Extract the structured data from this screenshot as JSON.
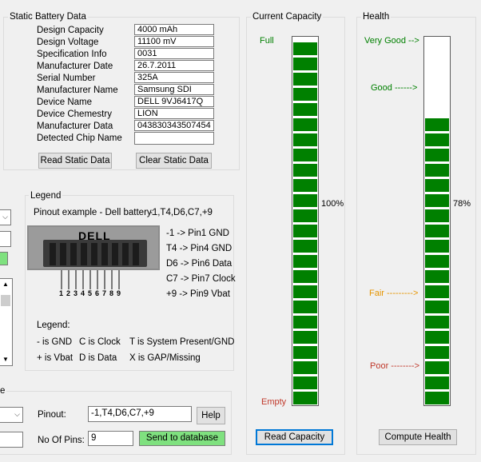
{
  "static": {
    "title": "Static Battery Data",
    "rows": [
      {
        "label": "Design Capacity",
        "value": "4000 mAh"
      },
      {
        "label": "Design Voltage",
        "value": "11100 mV"
      },
      {
        "label": "Specification Info",
        "value": "0031"
      },
      {
        "label": "Manufacturer Date",
        "value": "26.7.2011"
      },
      {
        "label": "Serial Number",
        "value": "325A"
      },
      {
        "label": "Manufacturer Name",
        "value": "Samsung SDI"
      },
      {
        "label": "Device Name",
        "value": "DELL 9VJ6417Q"
      },
      {
        "label": "Device Chemestry",
        "value": "LION"
      },
      {
        "label": "Manufacturer Data",
        "value": "043830343507454"
      },
      {
        "label": "Detected Chip Name",
        "value": ""
      }
    ],
    "read_btn": "Read Static Data",
    "clear_btn": "Clear Static Data"
  },
  "capacity": {
    "title": "Current Capacity",
    "full_label": "Full",
    "empty_label": "Empty",
    "percent_text": "100%",
    "fill_fraction": 1.0,
    "button": "Read Capacity"
  },
  "health": {
    "title": "Health",
    "very_good": "Very Good -->",
    "good": "Good ------>",
    "fair": "Fair --------->",
    "poor": "Poor -------->",
    "percent_text": "78%",
    "fill_fraction": 0.78,
    "button": "Compute Health"
  },
  "legend": {
    "title": "Legend",
    "pinout_example_label": "Pinout example - Dell battery:",
    "pinout_example_value": "-1,T4,D6,C7,+9",
    "connector_brand": "DELL",
    "pin_numbers": [
      "1",
      "2",
      "3",
      "4",
      "5",
      "6",
      "7",
      "8",
      "9"
    ],
    "mappings": [
      "-1 -> Pin1 GND",
      "T4 -> Pin4 GND",
      "D6 -> Pin6 Data",
      "C7 -> Pin7 Clock",
      "+9 -> Pin9 Vbat"
    ],
    "legend_heading": "Legend:",
    "codes_row1": [
      "- is GND",
      "C is Clock",
      "T is System Present/GND"
    ],
    "codes_row2": [
      "+ is Vbat",
      "D is Data",
      "X is GAP/Missing"
    ]
  },
  "database": {
    "title_fragment": "e",
    "pinout_label": "Pinout:",
    "pinout_value": "-1,T4,D6,C7,+9",
    "help_btn": "Help",
    "pins_label": "No Of Pins:",
    "pins_value": "9",
    "send_btn": "Send to database"
  },
  "colors": {
    "bar_green": "#008000",
    "label_green": "#008000",
    "label_orange": "#e69500",
    "label_red": "#c0392b",
    "empty_red": "#c0392b"
  }
}
